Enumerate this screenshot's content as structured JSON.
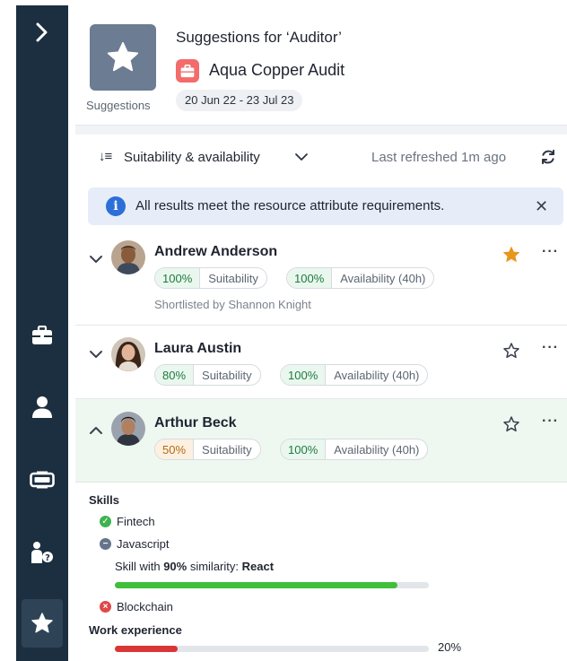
{
  "header": {
    "title": "Suggestions for ‘Auditor’",
    "project_name": "Aqua Copper Audit",
    "date_range": "20 Jun 22 - 23 Jul 23",
    "tile_caption": "Suggestions"
  },
  "toolbar": {
    "sort_label": "Suitability & availability",
    "last_refreshed": "Last refreshed 1m ago"
  },
  "banner": {
    "text": "All results meet the resource attribute requirements."
  },
  "candidates": [
    {
      "name": "Andrew Anderson",
      "suitability_pct": "100%",
      "suitability_label": "Suitability",
      "availability_pct": "100%",
      "availability_label": "Availability (40h)",
      "note": "Shortlisted by Shannon Knight",
      "starred": true,
      "expanded": false
    },
    {
      "name": "Laura Austin",
      "suitability_pct": "80%",
      "suitability_label": "Suitability",
      "availability_pct": "100%",
      "availability_label": "Availability (40h)",
      "starred": false,
      "expanded": false
    },
    {
      "name": "Arthur Beck",
      "suitability_pct": "50%",
      "suitability_label": "Suitability",
      "availability_pct": "100%",
      "availability_label": "Availability (40h)",
      "starred": false,
      "expanded": true
    }
  ],
  "details": {
    "skills_title": "Skills",
    "skills": [
      {
        "name": "Fintech",
        "status": "met"
      },
      {
        "name": "Javascript",
        "status": "partial"
      },
      {
        "name": "Blockchain",
        "status": "missing"
      }
    ],
    "similarity": {
      "prefix": "Skill with ",
      "pct": "90%",
      "middle": " similarity: ",
      "skill": "React",
      "fill": 0.9
    },
    "work_title": "Work experience",
    "work_pct": "20%",
    "work_fill": 0.2
  },
  "colors": {
    "sidebar": "#1c2f40",
    "accent_star": "#e8961c",
    "met": "#3fb34f",
    "partial": "#64748b",
    "missing": "#e04848",
    "bar_green": "#3fbf3a",
    "bar_red": "#d93636"
  },
  "sidebar_icons": [
    "chevron-right-icon",
    "briefcase-icon",
    "person-icon",
    "resource-card-icon",
    "person-question-icon",
    "star-icon"
  ]
}
